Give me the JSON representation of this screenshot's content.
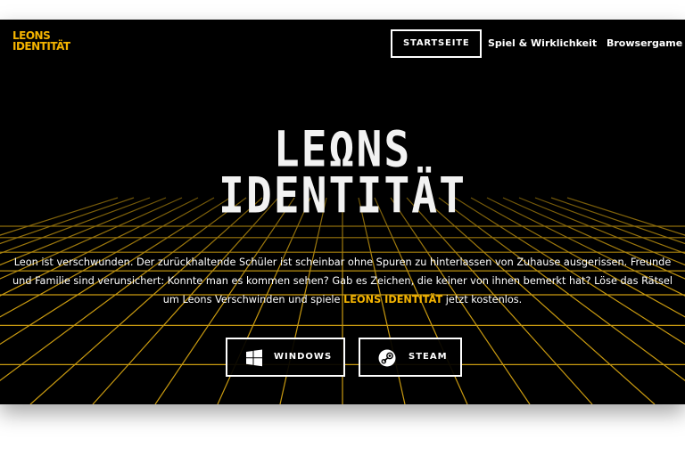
{
  "brand": {
    "line1": "LEONS",
    "line2": "IDENTITÄT"
  },
  "nav": {
    "items": [
      {
        "label": "STARTSEITE",
        "active": true
      },
      {
        "label": "Spiel & Wirklichkeit",
        "active": false
      },
      {
        "label": "Browsergame",
        "active": false
      }
    ]
  },
  "hero": {
    "logo_line1": "LEΩNS",
    "logo_line2": "IDENTITÄT",
    "description_part1": "Leon ist verschwunden. Der zurückhaltende Schüler ist scheinbar ohne Spuren zu hinterlassen von Zuhause ausgerissen. Freunde und Familie sind verunsichert: Konnte man es kommen sehen? Gab es Zeichen, die keiner von ihnen bemerkt hat? Löse das Rätsel um Leons Verschwinden und spiele ",
    "description_highlight": "LEONS IDENTITÄT",
    "description_part2": " jetzt kostenlos."
  },
  "buttons": {
    "windows": {
      "label": "WINDOWS",
      "icon": "windows-icon"
    },
    "steam": {
      "label": "STEAM",
      "icon": "steam-icon"
    }
  },
  "colors": {
    "accent": "#f5b400",
    "background": "#000000",
    "text": "#ffffff"
  }
}
